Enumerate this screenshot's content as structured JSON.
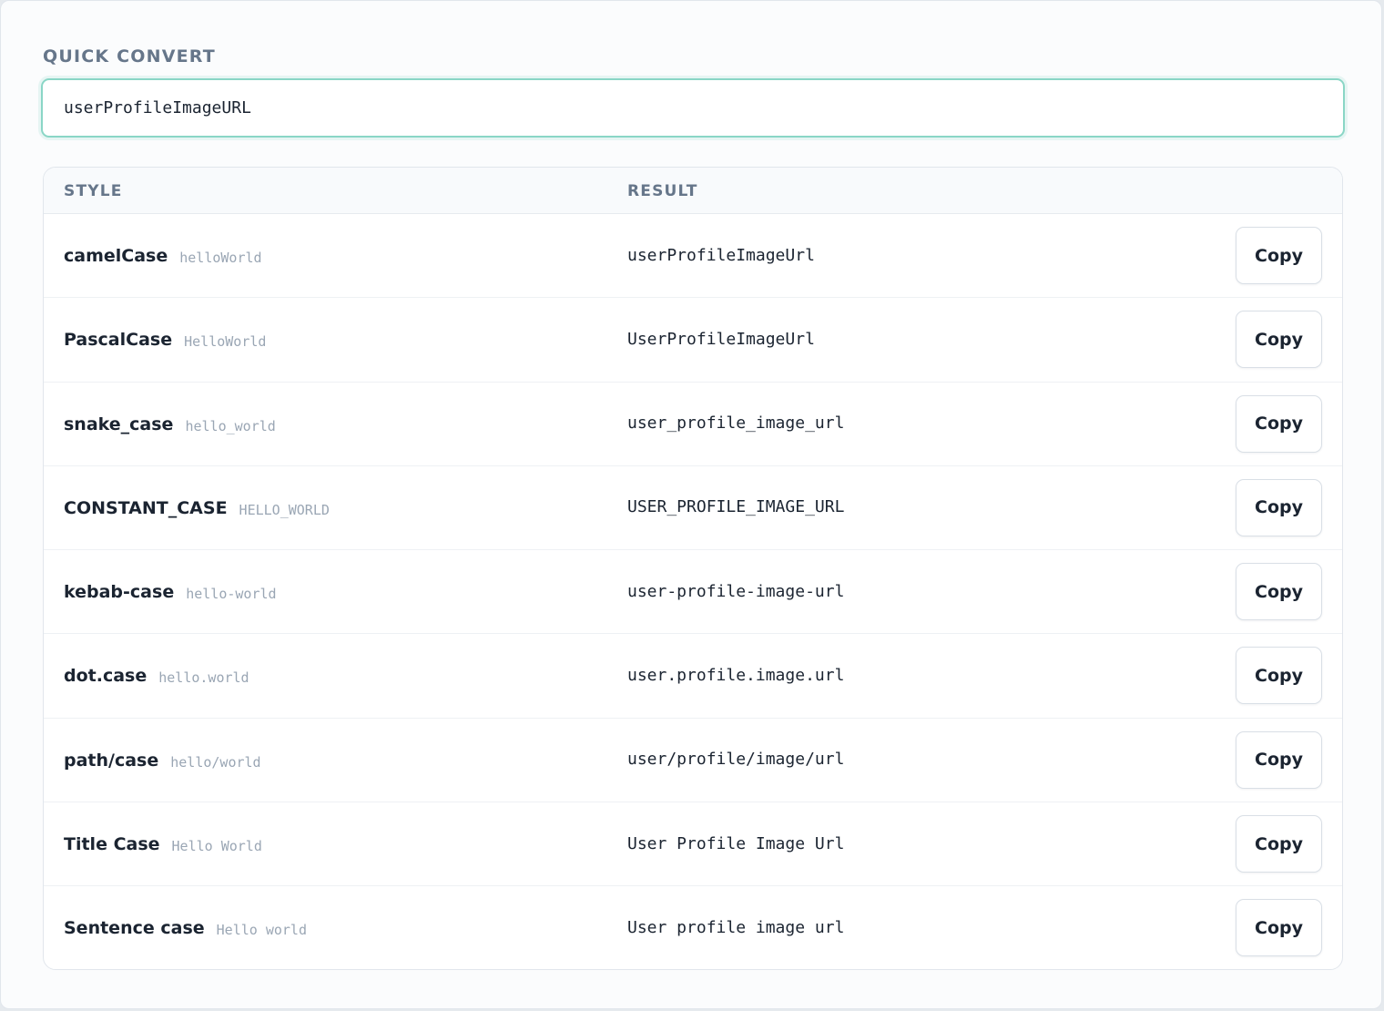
{
  "quick_convert": {
    "label": "QUICK CONVERT",
    "input_value": "userProfileImageURL"
  },
  "table": {
    "headers": {
      "style": "STYLE",
      "result": "RESULT"
    },
    "copy_label": "Copy",
    "rows": [
      {
        "style": "camelCase",
        "example": "helloWorld",
        "result": "userProfileImageUrl"
      },
      {
        "style": "PascalCase",
        "example": "HelloWorld",
        "result": "UserProfileImageUrl"
      },
      {
        "style": "snake_case",
        "example": "hello_world",
        "result": "user_profile_image_url"
      },
      {
        "style": "CONSTANT_CASE",
        "example": "HELLO_WORLD",
        "result": "USER_PROFILE_IMAGE_URL"
      },
      {
        "style": "kebab-case",
        "example": "hello-world",
        "result": "user-profile-image-url"
      },
      {
        "style": "dot.case",
        "example": "hello.world",
        "result": "user.profile.image.url"
      },
      {
        "style": "path/case",
        "example": "hello/world",
        "result": "user/profile/image/url"
      },
      {
        "style": "Title Case",
        "example": "Hello World",
        "result": "User Profile Image Url"
      },
      {
        "style": "Sentence case",
        "example": "Hello world",
        "result": "User profile image url"
      }
    ]
  },
  "colors": {
    "input_focus_border": "#8ad6c6",
    "label_text": "#66768a",
    "primary_text": "#1b2431",
    "example_text": "#9aa6b4"
  }
}
